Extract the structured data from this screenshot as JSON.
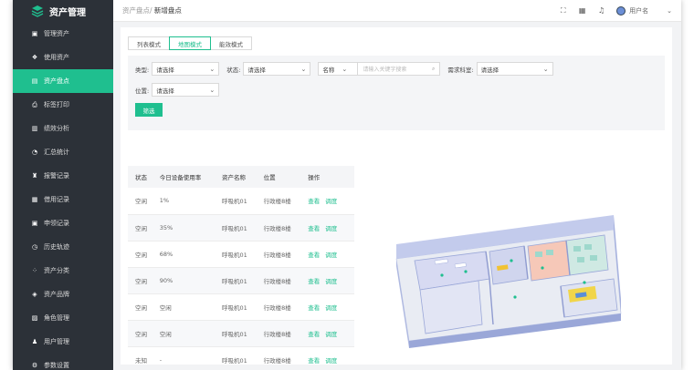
{
  "app": {
    "title": "资产管理"
  },
  "sidebar": {
    "items": [
      {
        "label": "管理资产",
        "icon": "manage-icon",
        "glyph": "▣"
      },
      {
        "label": "使用资产",
        "icon": "use-icon",
        "glyph": "❖"
      },
      {
        "label": "资产盘点",
        "icon": "inventory-icon",
        "glyph": "▤"
      },
      {
        "label": "标签打印",
        "icon": "printer-icon",
        "glyph": "⎙"
      },
      {
        "label": "绩效分析",
        "icon": "bar-chart-icon",
        "glyph": "▥"
      },
      {
        "label": "汇总统计",
        "icon": "summary-icon",
        "glyph": "◔"
      },
      {
        "label": "报警记录",
        "icon": "alarm-icon",
        "glyph": "♜"
      },
      {
        "label": "借用记录",
        "icon": "borrow-icon",
        "glyph": "▦"
      },
      {
        "label": "申领记录",
        "icon": "apply-icon",
        "glyph": "▣"
      },
      {
        "label": "历史轨迹",
        "icon": "history-icon",
        "glyph": "◷"
      },
      {
        "label": "资产分类",
        "icon": "category-icon",
        "glyph": "⁘"
      },
      {
        "label": "资产品牌",
        "icon": "brand-icon",
        "glyph": "◈"
      },
      {
        "label": "角色管理",
        "icon": "role-icon",
        "glyph": "▨"
      },
      {
        "label": "用户管理",
        "icon": "user-manage-icon",
        "glyph": "♟"
      },
      {
        "label": "参数设置",
        "icon": "settings-icon",
        "glyph": "⚙"
      }
    ],
    "active_index": 2
  },
  "header": {
    "breadcrumb_parent": "资产盘点/",
    "breadcrumb_current": "新增盘点",
    "username": "用户名"
  },
  "tabs": [
    "列表模式",
    "地图模式",
    "能效模式"
  ],
  "active_tab": 1,
  "filters": {
    "type_label": "类型:",
    "type_value": "请选择",
    "status_label": "状态:",
    "status_value": "请选择",
    "name_select": "名称",
    "search_placeholder": "请输入关键字搜索",
    "dept_label": "需求科室:",
    "dept_value": "请选择",
    "location_label": "位置:",
    "location_value": "请选择",
    "submit_label": "筛选"
  },
  "table": {
    "columns": [
      "状态",
      "今日设备使用率",
      "资产名称",
      "位置",
      "操作"
    ],
    "rows": [
      {
        "status": "空闲",
        "usage": "1%",
        "name": "呼吸机01",
        "location": "行政楼8楼",
        "view": "查看",
        "transfer": "调度"
      },
      {
        "status": "空闲",
        "usage": "35%",
        "name": "呼吸机01",
        "location": "行政楼8楼",
        "view": "查看",
        "transfer": "调度"
      },
      {
        "status": "空闲",
        "usage": "68%",
        "name": "呼吸机01",
        "location": "行政楼8楼",
        "view": "查看",
        "transfer": "调度"
      },
      {
        "status": "空闲",
        "usage": "90%",
        "name": "呼吸机01",
        "location": "行政楼8楼",
        "view": "查看",
        "transfer": "调度"
      },
      {
        "status": "空闲",
        "usage": "空闲",
        "name": "呼吸机01",
        "location": "行政楼8楼",
        "view": "查看",
        "transfer": "调度"
      },
      {
        "status": "空闲",
        "usage": "空闲",
        "name": "呼吸机01",
        "location": "行政楼8楼",
        "view": "查看",
        "transfer": "调度"
      },
      {
        "status": "未知",
        "usage": "-",
        "name": "呼吸机01",
        "location": "行政楼8楼",
        "view": "查看",
        "transfer": "调度"
      }
    ]
  },
  "colors": {
    "accent": "#1fbf8f",
    "sidebar": "#2c3138",
    "wall": "#b8c2e6",
    "floor": "#e9ecf3"
  }
}
